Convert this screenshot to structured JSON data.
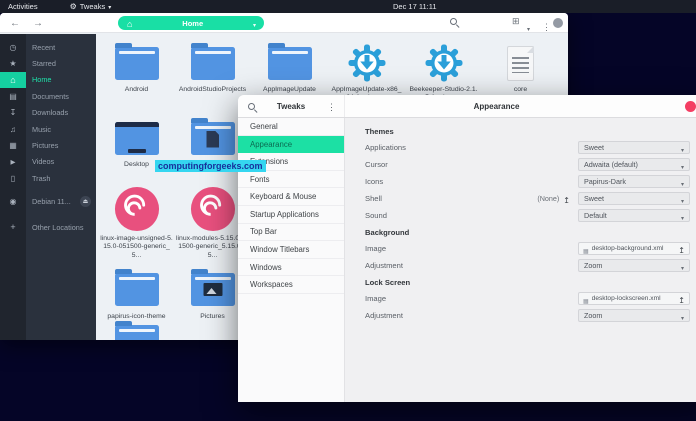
{
  "topbar": {
    "activities": "Activities",
    "app_menu": "Tweaks",
    "clock": "Dec 17 11:11"
  },
  "watermark": "computingforgeeks.com",
  "file_manager": {
    "toolbar": {
      "location": "Home"
    },
    "sidebar": [
      {
        "label": "Recent",
        "icon": "clock-icon"
      },
      {
        "label": "Starred",
        "icon": "star-icon"
      },
      {
        "label": "Home",
        "icon": "home-icon",
        "selected": true
      },
      {
        "label": "Documents",
        "icon": "document-icon"
      },
      {
        "label": "Downloads",
        "icon": "download-icon"
      },
      {
        "label": "Music",
        "icon": "music-icon"
      },
      {
        "label": "Pictures",
        "icon": "picture-icon"
      },
      {
        "label": "Videos",
        "icon": "video-icon"
      },
      {
        "label": "Trash",
        "icon": "trash-icon"
      },
      {
        "label": "Debian 11...",
        "icon": "disk-icon",
        "eject": true
      },
      {
        "label": "Other Locations",
        "icon": "plus-icon"
      }
    ],
    "files": [
      {
        "name": "Android",
        "type": "folder"
      },
      {
        "name": "AndroidStudioProjects",
        "type": "folder"
      },
      {
        "name": "AppImageUpdate",
        "type": "folder"
      },
      {
        "name": "AppImageUpdate-x86_64.AppImage",
        "type": "appimage"
      },
      {
        "name": "Beekeeper-Studio-2.1.5.AppImage",
        "type": "appimage"
      },
      {
        "name": "core",
        "type": "text-file"
      },
      {
        "name": "Desktop",
        "type": "desktop-folder"
      },
      {
        "name": "Documents",
        "type": "documents-folder"
      },
      {
        "name": "linux-image-unsigned-5.15.0-051500-generic_5...",
        "type": "deb-package"
      },
      {
        "name": "linux-modules-5.15.0-051500-generic_5.15.0-05...",
        "type": "deb-package"
      },
      {
        "name": "papirus-icon-theme",
        "type": "folder"
      },
      {
        "name": "Pictures",
        "type": "pictures-folder"
      },
      {
        "name": "",
        "type": "folder"
      }
    ]
  },
  "tweaks": {
    "window_title": "Tweaks",
    "panel_title": "Appearance",
    "selected_item": "Appearance",
    "sidebar": [
      "General",
      "Appearance",
      "Extensions",
      "Fonts",
      "Keyboard & Mouse",
      "Startup Applications",
      "Top Bar",
      "Window Titlebars",
      "Windows",
      "Workspaces"
    ],
    "sections": [
      {
        "heading": "Themes",
        "rows": [
          {
            "label": "Applications",
            "value": "Sweet"
          },
          {
            "label": "Cursor",
            "value": "Adwaita (default)"
          },
          {
            "label": "Icons",
            "value": "Papirus-Dark"
          },
          {
            "label": "Shell",
            "prefix": "(None)",
            "value": "Sweet"
          },
          {
            "label": "Sound",
            "value": "Default"
          }
        ]
      },
      {
        "heading": "Background",
        "rows": [
          {
            "label": "Image",
            "value": "desktop-background.xml",
            "file": true
          },
          {
            "label": "Adjustment",
            "value": "Zoom"
          }
        ]
      },
      {
        "heading": "Lock Screen",
        "rows": [
          {
            "label": "Image",
            "value": "desktop-lockscreen.xml",
            "file": true
          },
          {
            "label": "Adjustment",
            "value": "Zoom"
          }
        ]
      }
    ]
  },
  "colors": {
    "accent_green": "#19DFA5",
    "folder_blue": "#5294E2",
    "deb_pink": "#E8507E",
    "appimage_blue": "#2B9FD9",
    "close_button": "#F43E63",
    "watermark_bg": "#35D6F0",
    "topbar_bg": "#1A1E28",
    "desktop_bg": "#050527"
  }
}
